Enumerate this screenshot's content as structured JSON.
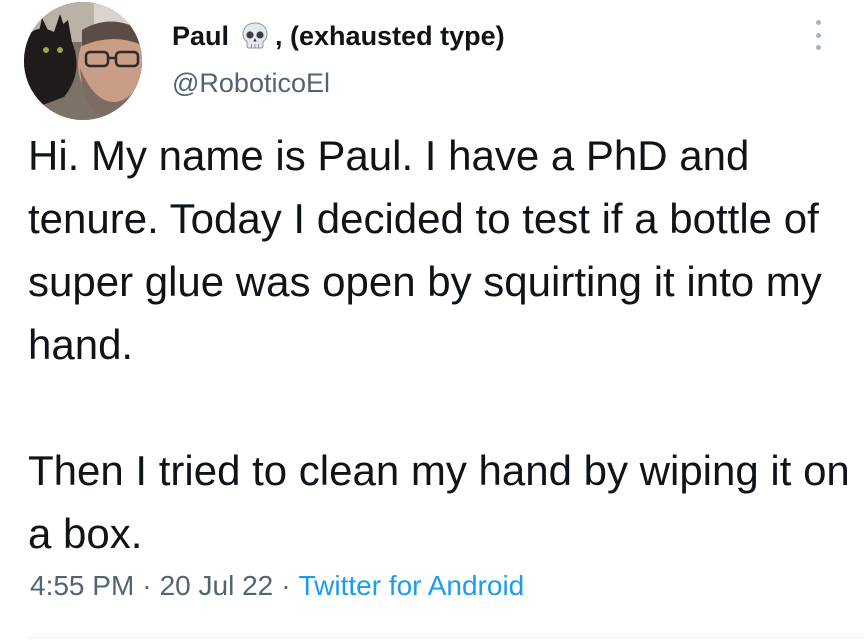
{
  "tweet": {
    "display_name": "Paul",
    "display_name_suffix": ", (exhausted type)",
    "name_emoji_icon": "skull-icon",
    "handle": "@RoboticoEl",
    "text": "Hi. My name is Paul. I have a PhD and tenure. Today I decided to test if a bottle of super glue was open by squirting it into my hand.\n\nThen I tried to clean my hand by wiping it on a box.",
    "time": "4:55 PM",
    "date": "20 Jul 22",
    "separator": "·",
    "source": "Twitter for Android"
  },
  "colors": {
    "text": "#0f1419",
    "secondary": "#536471",
    "link": "#1d9bf0",
    "divider": "#eff3f4"
  }
}
